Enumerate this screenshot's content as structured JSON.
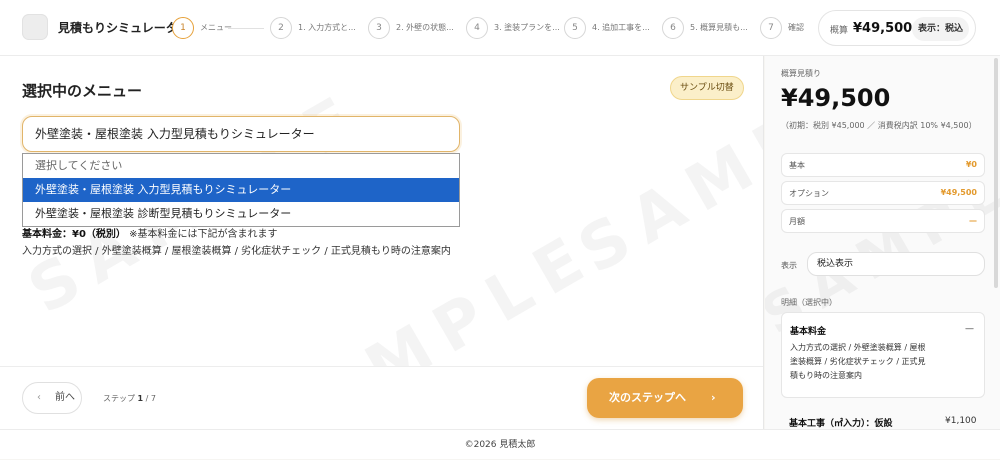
{
  "header": {
    "app_title": "見積もりシミュレーター",
    "steps": [
      {
        "num": "1",
        "label": "メニュー"
      },
      {
        "num": "2",
        "label": "1. 入力方式と..."
      },
      {
        "num": "3",
        "label": "2. 外壁の状態..."
      },
      {
        "num": "4",
        "label": "3. 塗装プランを..."
      },
      {
        "num": "5",
        "label": "4. 追加工事を..."
      },
      {
        "num": "6",
        "label": "5. 概算見積も..."
      },
      {
        "num": "7",
        "label": "確認"
      }
    ],
    "total_caption": "概算",
    "total_amount": "¥49,500",
    "display_mode": "表示：税込"
  },
  "main": {
    "section_title": "選択中のメニュー",
    "sample_toggle_label": "サンプル切替",
    "select_value": "外壁塗装・屋根塗装 入力型見積もりシミュレーター",
    "options": [
      "選択してください",
      "外壁塗装・屋根塗装 入力型見積もりシミュレーター",
      "外壁塗装・屋根塗装 診断型見積もりシミュレーター"
    ],
    "basic_fee_label": "基本料金：¥0（税別）",
    "basic_fee_note": "※基本料金には下記が含まれます",
    "description": "入力方式の選択 / 外壁塗装概算 / 屋根塗装概算 / 劣化症状チェック / 正式見積もり時の注意案内",
    "watermark": "SAMPLE",
    "prev_label": "前へ",
    "step_prefix": "ステップ",
    "step_current": "1",
    "step_total": " / 7",
    "next_label": "次のステップへ"
  },
  "sidebar": {
    "caption": "概算見積り",
    "amount": "¥49,500",
    "sub": "（初期：税別 ¥45,000 ／ 消費税内訳 10% ¥4,500）",
    "rows": [
      {
        "label": "基本",
        "value": "¥0"
      },
      {
        "label": "オプション",
        "value": "¥49,500"
      },
      {
        "label": "月額",
        "value": "—"
      }
    ],
    "display_label": "表示",
    "display_value": "税込表示",
    "detail_caption": "明細（選択中）",
    "detail_name": "基本料金",
    "detail_dash": "—",
    "detail_text": "入力方式の選択 / 外壁塗装概算 / 屋根塗装概算 / 劣化症状チェック / 正式見積もり時の注意案内",
    "detail2_name": "基本工事（㎡入力）：仮設",
    "detail2_price": "¥1,100"
  },
  "footer": {
    "copyright": "©2026 見積太郎"
  },
  "colors": {
    "accent": "#e9a443",
    "selected_option": "#1e64c8",
    "price_orange": "#e39a2e"
  }
}
